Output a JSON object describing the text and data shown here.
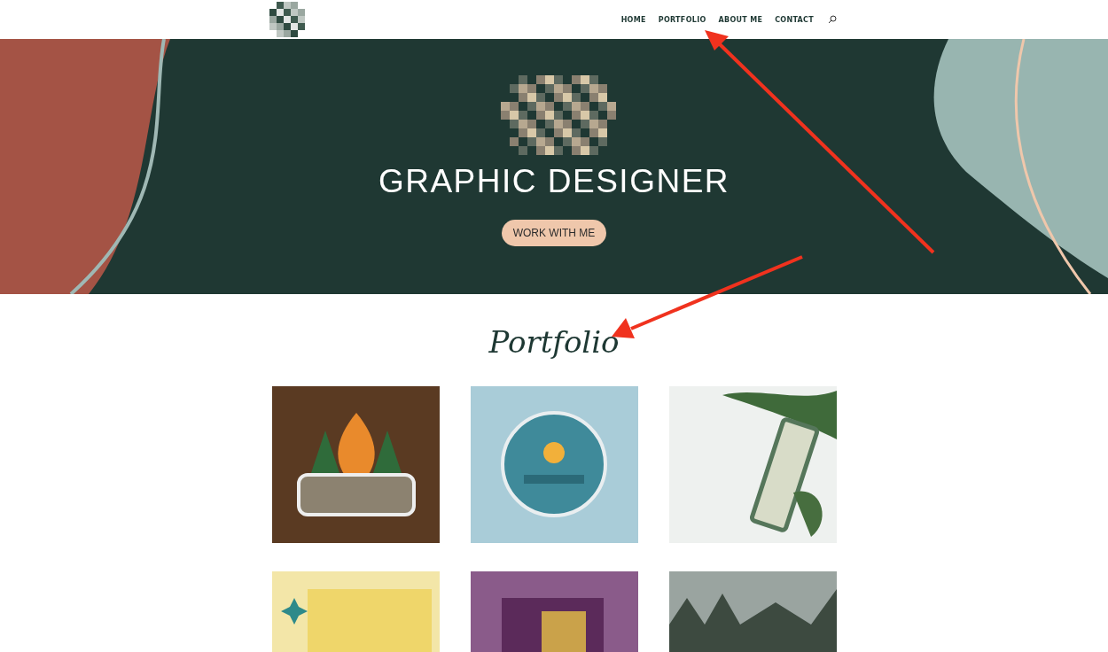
{
  "header": {
    "nav": [
      "HOME",
      "PORTFOLIO",
      "ABOUT ME",
      "CONTACT"
    ]
  },
  "hero": {
    "title": "GRAPHIC DESIGNER",
    "button": "WORK WITH ME"
  },
  "portfolio": {
    "title": "Portfolio",
    "tiles": [
      {
        "kind": "campfire"
      },
      {
        "kind": "badge"
      },
      {
        "kind": "tube"
      },
      {
        "kind": "poster"
      },
      {
        "kind": "booklet"
      },
      {
        "kind": "forest"
      }
    ]
  }
}
